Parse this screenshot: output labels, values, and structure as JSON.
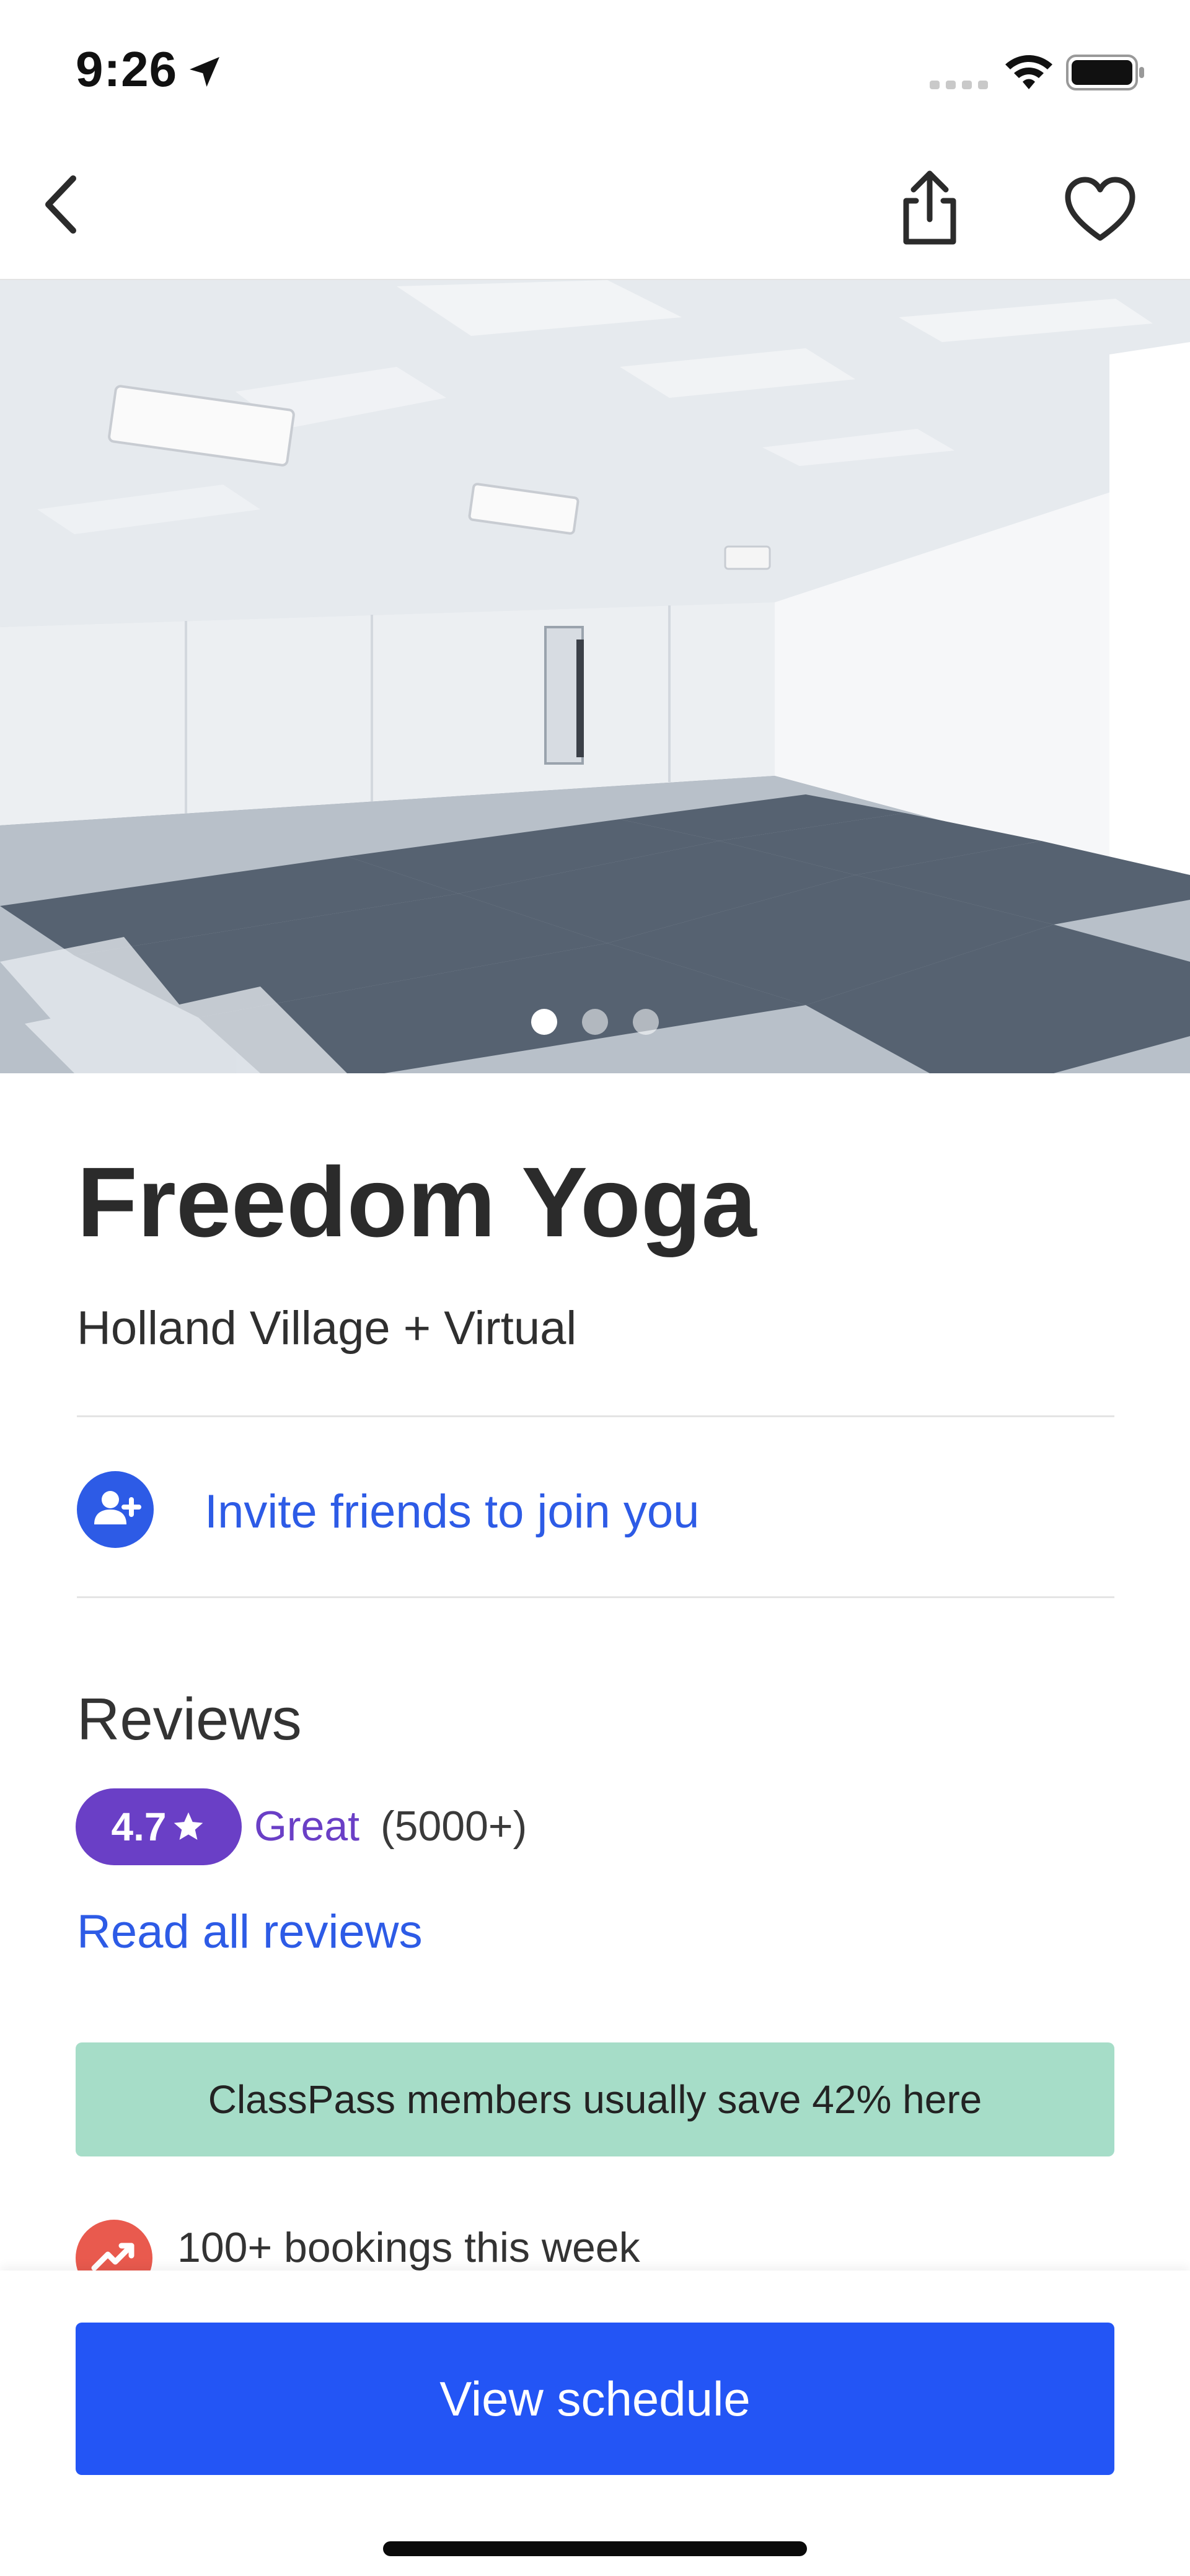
{
  "status_bar": {
    "time": "9:26",
    "icons": [
      "location-arrow-icon",
      "cellular-signal-icon",
      "wifi-icon",
      "battery-icon"
    ]
  },
  "nav": {
    "icons": [
      "chevron-left-icon",
      "share-icon",
      "heart-icon"
    ]
  },
  "hero": {
    "image_desc_icon": "studio-photo",
    "carousel": {
      "total": 3,
      "active_index": 0
    }
  },
  "studio": {
    "name": "Freedom Yoga",
    "location": "Holland Village + Virtual"
  },
  "invite": {
    "label": "Invite friends to join you",
    "icon": "add-person-icon"
  },
  "reviews": {
    "title": "Reviews",
    "rating": "4.7",
    "rating_label": "Great",
    "count": "(5000+)",
    "read_all": "Read all reviews"
  },
  "savings": {
    "text": "ClassPass members usually save 42% here"
  },
  "bookings": {
    "text": "100+ bookings this week",
    "icon": "trending-up-icon"
  },
  "cta": {
    "label": "View schedule"
  },
  "colors": {
    "accent_blue": "#2355f5",
    "link_blue": "#2d5be6",
    "rating_purple": "#6a3fc6",
    "savings_green": "#a6ddc8",
    "trend_red": "#e95a4e"
  }
}
